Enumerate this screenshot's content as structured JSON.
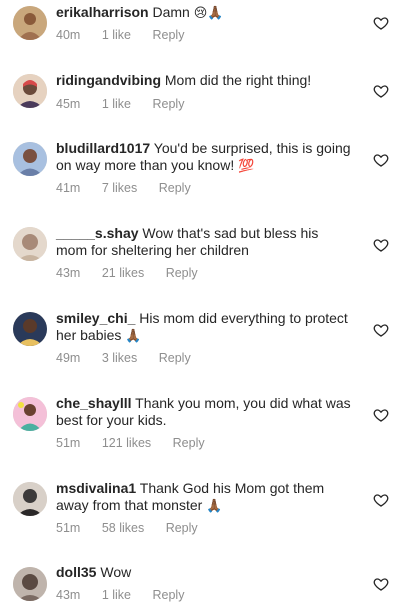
{
  "comments": [
    {
      "username": "erikalharrison",
      "text": "Damn",
      "emoji": "😢🙏🏾",
      "time": "40m",
      "likes": "1 like",
      "reply": "Reply",
      "avatar_color": "#c9a77c"
    },
    {
      "username": "ridingandvibing",
      "text": "Mom did the right thing!",
      "emoji": "",
      "time": "45m",
      "likes": "1 like",
      "reply": "Reply",
      "avatar_color": "#b08a7a"
    },
    {
      "username": "bludillard1017",
      "text": "You'd be surprised, this is going on way more than you know!",
      "emoji": "💯",
      "time": "41m",
      "likes": "7 likes",
      "reply": "Reply",
      "avatar_color": "#6a7fa8"
    },
    {
      "username": "_____s.shay",
      "text": "Wow that's sad but bless his mom for sheltering her children",
      "emoji": "",
      "time": "43m",
      "likes": "21 likes",
      "reply": "Reply",
      "avatar_color": "#c8b4a0"
    },
    {
      "username": "smiley_chi_",
      "text": "His mom did everything to protect her babies",
      "emoji": "🙏🏾",
      "time": "49m",
      "likes": "3 likes",
      "reply": "Reply",
      "avatar_color": "#3a4a6a"
    },
    {
      "username": "che_shaylll",
      "text": "Thank you mom, you did what was best for your kids.",
      "emoji": "",
      "time": "51m",
      "likes": "121 likes",
      "reply": "Reply",
      "avatar_color": "#d98aa8"
    },
    {
      "username": "msdivalina1",
      "text": "Thank God his Mom got them away from that monster",
      "emoji": "🙏🏾",
      "time": "51m",
      "likes": "58 likes",
      "reply": "Reply",
      "avatar_color": "#3c3a3a"
    },
    {
      "username": "doll35",
      "text": "Wow",
      "emoji": "",
      "time": "43m",
      "likes": "1 like",
      "reply": "Reply",
      "avatar_color": "#7a6a62"
    }
  ],
  "icons": {
    "like": "heart-outline-icon"
  },
  "colors": {
    "text": "#262626",
    "meta": "#8e8e8e",
    "heart": "#262626"
  }
}
